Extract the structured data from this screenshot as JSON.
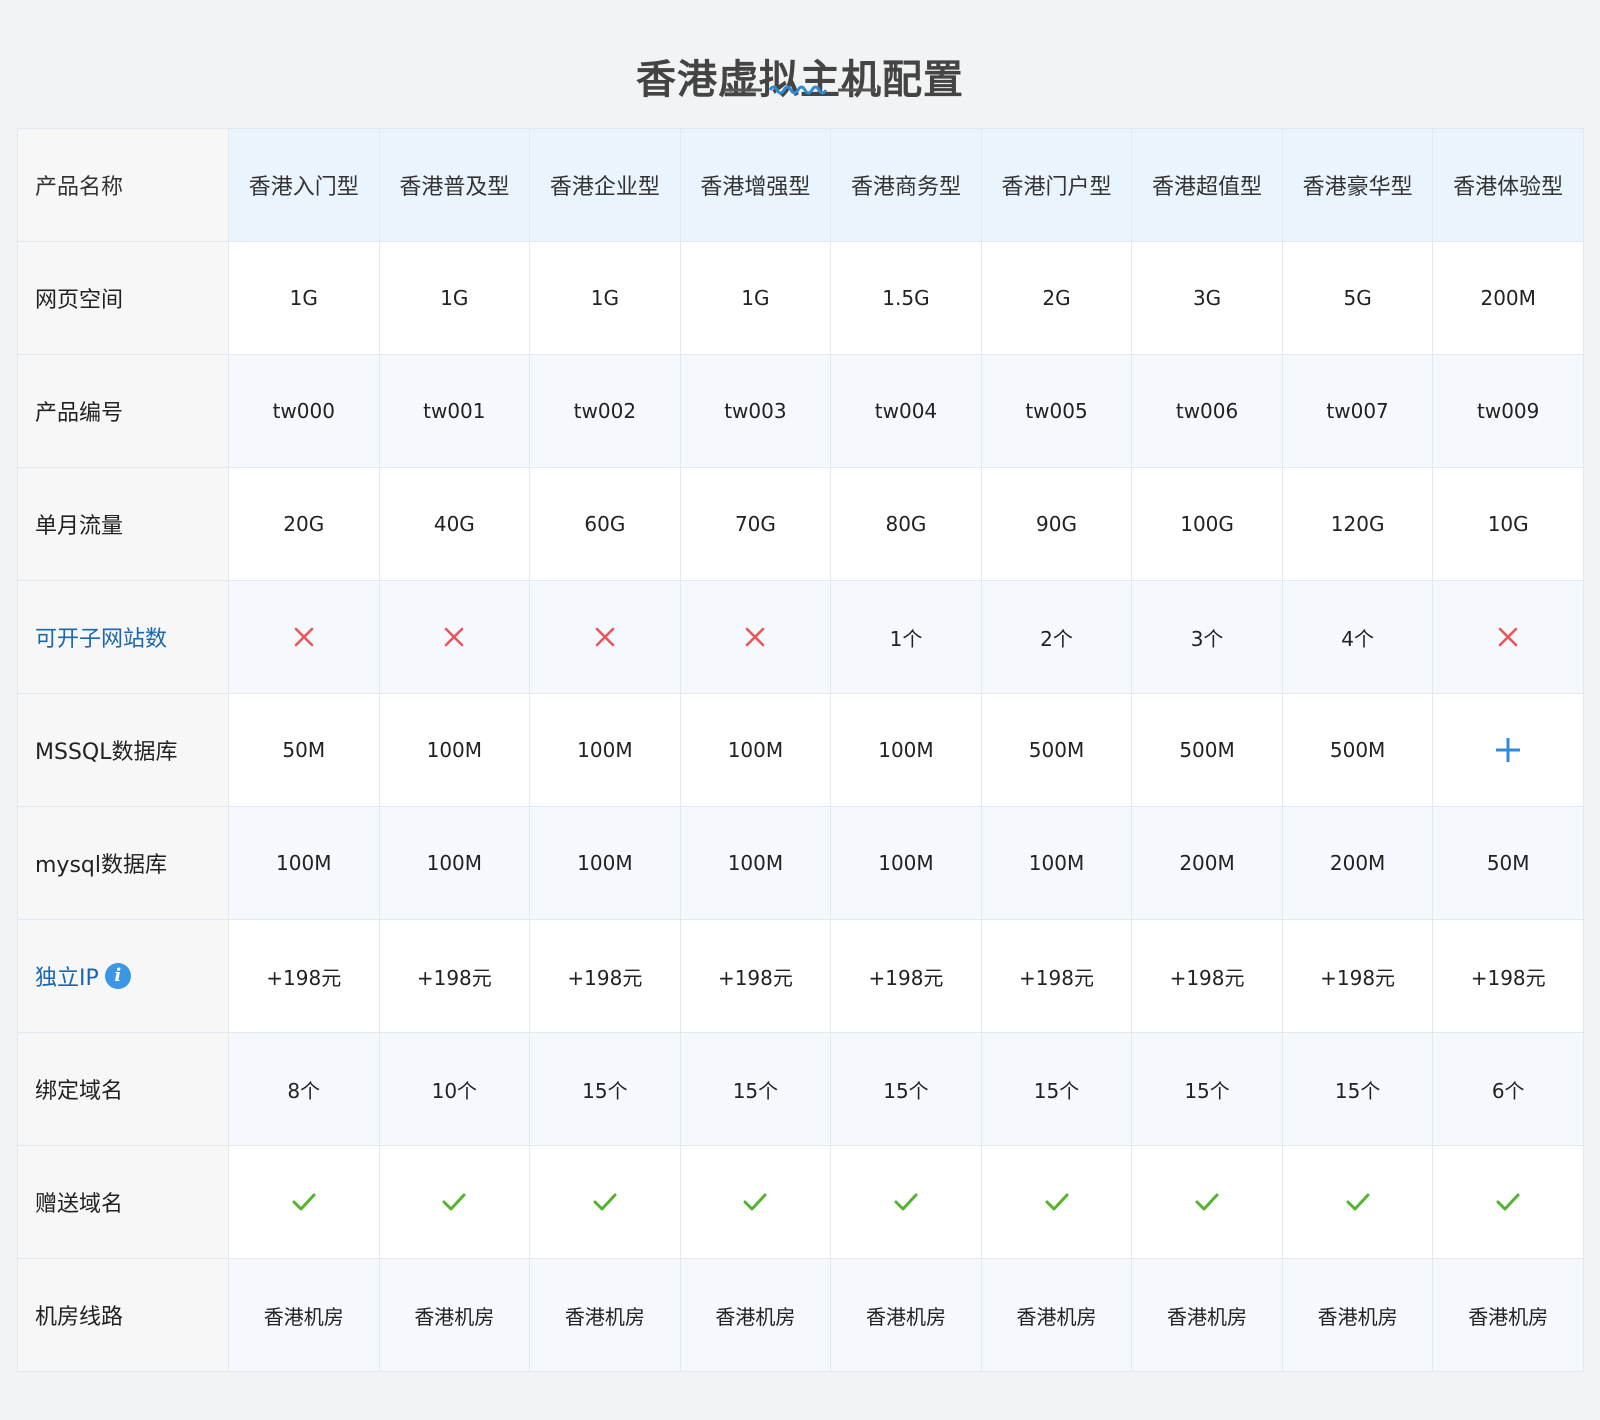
{
  "title": "香港虚拟主机配置",
  "colors": {
    "accent": "#2f8ad8",
    "cross": "#e9565a",
    "check": "#52b52c",
    "plus": "#2f8ad8",
    "header_bg": "#e9f4fd",
    "alt_row_bg": "#f5f9fd"
  },
  "table": {
    "header": {
      "label": "产品名称",
      "columns": [
        "香港入门型",
        "香港普及型",
        "香港企业型",
        "香港增强型",
        "香港商务型",
        "香港门户型",
        "香港超值型",
        "香港豪华型",
        "香港体验型"
      ]
    },
    "rows": [
      {
        "key": "web-space",
        "label": "网页空间",
        "label_style": "normal",
        "cells": [
          "1G",
          "1G",
          "1G",
          "1G",
          "1.5G",
          "2G",
          "3G",
          "5G",
          "200M"
        ]
      },
      {
        "key": "product-code",
        "label": "产品编号",
        "label_style": "normal",
        "cells": [
          "tw000",
          "tw001",
          "tw002",
          "tw003",
          "tw004",
          "tw005",
          "tw006",
          "tw007",
          "tw009"
        ]
      },
      {
        "key": "monthly-traffic",
        "label": "单月流量",
        "label_style": "normal",
        "cells": [
          "20G",
          "40G",
          "60G",
          "70G",
          "80G",
          "90G",
          "100G",
          "120G",
          "10G"
        ]
      },
      {
        "key": "subsites",
        "label": "可开子网站数",
        "label_style": "link",
        "cells": [
          "cross-icon",
          "cross-icon",
          "cross-icon",
          "cross-icon",
          "1个",
          "2个",
          "3个",
          "4个",
          "cross-icon"
        ]
      },
      {
        "key": "mssql",
        "label": "MSSQL数据库",
        "label_style": "normal",
        "cells": [
          "50M",
          "100M",
          "100M",
          "100M",
          "100M",
          "500M",
          "500M",
          "500M",
          "plus-icon"
        ]
      },
      {
        "key": "mysql",
        "label": "mysql数据库",
        "label_style": "normal",
        "cells": [
          "100M",
          "100M",
          "100M",
          "100M",
          "100M",
          "100M",
          "200M",
          "200M",
          "50M"
        ]
      },
      {
        "key": "dedicated-ip",
        "label": "独立IP",
        "label_style": "link",
        "label_icon": "info-icon",
        "label_icon_glyph": "i",
        "cells": [
          "+198元",
          "+198元",
          "+198元",
          "+198元",
          "+198元",
          "+198元",
          "+198元",
          "+198元",
          "+198元"
        ]
      },
      {
        "key": "bound-domains",
        "label": "绑定域名",
        "label_style": "normal",
        "cells": [
          "8个",
          "10个",
          "15个",
          "15个",
          "15个",
          "15个",
          "15个",
          "15个",
          "6个"
        ]
      },
      {
        "key": "free-domain",
        "label": "赠送域名",
        "label_style": "normal",
        "cells": [
          "check-icon",
          "check-icon",
          "check-icon",
          "check-icon",
          "check-icon",
          "check-icon",
          "check-icon",
          "check-icon",
          "check-icon"
        ]
      },
      {
        "key": "datacenter-line",
        "label": "机房线路",
        "label_style": "normal",
        "cells": [
          "香港机房",
          "香港机房",
          "香港机房",
          "香港机房",
          "香港机房",
          "香港机房",
          "香港机房",
          "香港机房",
          "香港机房"
        ]
      }
    ]
  }
}
